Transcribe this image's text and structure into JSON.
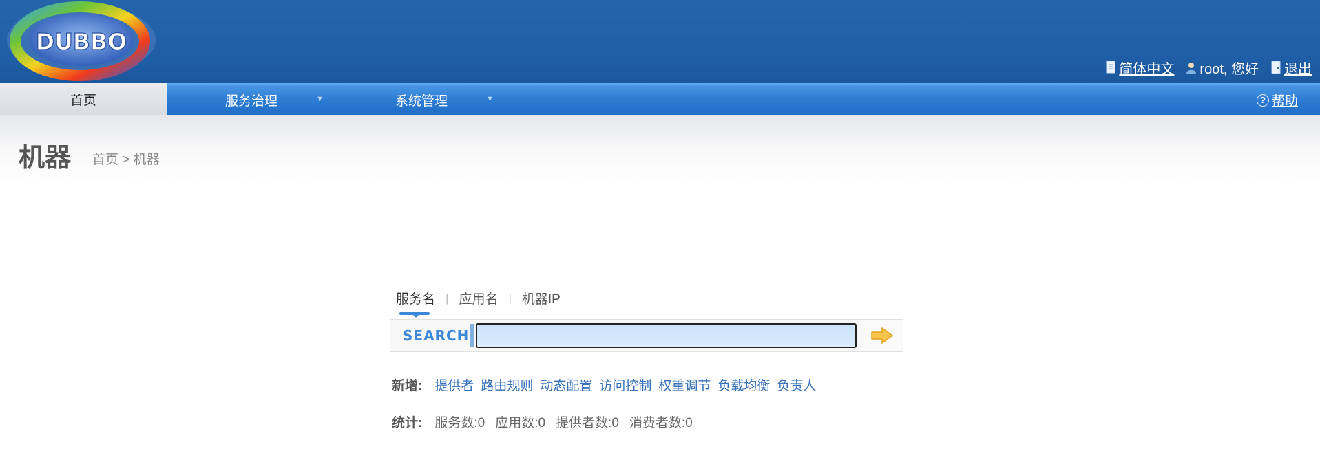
{
  "header": {
    "logo_text": "DUBBO",
    "language_label": "简体中文",
    "user_greeting": "root, 您好",
    "logout_label": "退出"
  },
  "nav": {
    "items": [
      {
        "label": "首页",
        "active": true
      },
      {
        "label": "服务治理",
        "has_dropdown": true
      },
      {
        "label": "系统管理",
        "has_dropdown": true
      }
    ],
    "help_label": "帮助"
  },
  "page": {
    "title": "机器",
    "breadcrumb": "首页 > 机器"
  },
  "search": {
    "tabs": [
      {
        "label": "服务名",
        "active": true
      },
      {
        "label": "应用名"
      },
      {
        "label": "机器IP"
      }
    ],
    "tab_separator": "|",
    "label": "SEARCH",
    "value": ""
  },
  "add": {
    "label": "新增:",
    "links": [
      "提供者",
      "路由规则",
      "动态配置",
      "访问控制",
      "权重调节",
      "负载均衡",
      "负责人"
    ]
  },
  "stats": {
    "label": "统计:",
    "items": [
      "服务数:0",
      "应用数:0",
      "提供者数:0",
      "消费者数:0"
    ]
  },
  "colors": {
    "header_bg": "#1f5ea6",
    "nav_bg": "#2f7ed5",
    "link": "#3570b9",
    "search_accent": "#3b88d6"
  }
}
